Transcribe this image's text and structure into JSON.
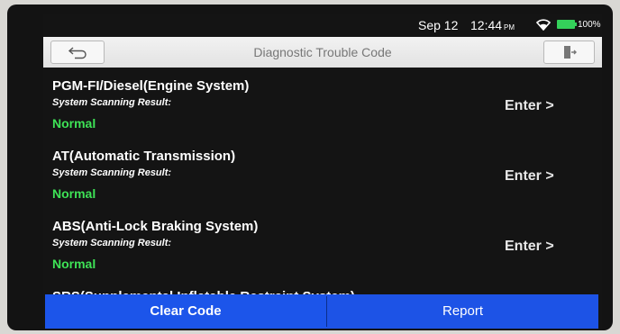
{
  "status_bar": {
    "date": "Sep 12",
    "time": "12:44",
    "ampm": "PM",
    "wifi_icon": "wifi-icon",
    "battery_icon": "battery-icon",
    "battery": "100%",
    "battery_color": "#34d05a"
  },
  "titlebar": {
    "title": "Diagnostic Trouble Code",
    "back_icon": "back-arrow-icon",
    "exit_icon": "exit-door-icon"
  },
  "systems": [
    {
      "name": "PGM-FI/Diesel(Engine System)",
      "label": "System Scanning Result:",
      "result": "Normal",
      "action": "Enter >"
    },
    {
      "name": "AT(Automatic Transmission)",
      "label": "System Scanning Result:",
      "result": "Normal",
      "action": "Enter >"
    },
    {
      "name": "ABS(Anti-Lock Braking System)",
      "label": "System Scanning Result:",
      "result": "Normal",
      "action": "Enter >"
    }
  ],
  "partial_item": {
    "name": "SRS(Supplemental Inflatable Restraint System)"
  },
  "bottom_bar": {
    "clear_label": "Clear Code",
    "report_label": "Report",
    "accent_color": "#1d53e6",
    "normal_color": "#3ee256"
  }
}
